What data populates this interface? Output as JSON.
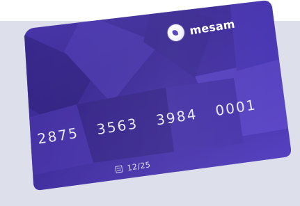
{
  "card": {
    "brand": "mesam",
    "number_groups": [
      "2875",
      "3563",
      "3984",
      "0001"
    ],
    "expiry": "12/25"
  },
  "colors": {
    "card_dark": "#3b2a8e",
    "card_mid": "#4b37ad",
    "card_light": "#5f4ad0",
    "backdrop": "#dde0ea"
  },
  "icons": {
    "logo": "mesam-logo-icon",
    "chip": "card-chip-icon"
  }
}
